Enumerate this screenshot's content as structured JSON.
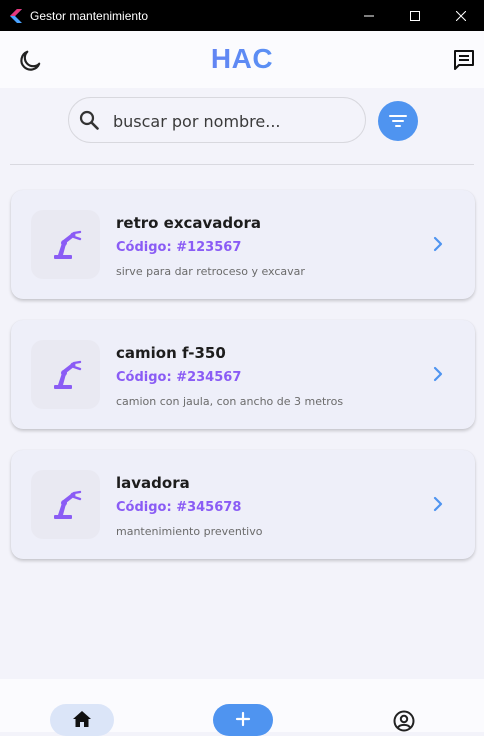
{
  "window": {
    "title": "Gestor mantenimiento",
    "controls": [
      "minimize-icon",
      "maximize-icon",
      "close-icon"
    ]
  },
  "appbar": {
    "logo": "HAC",
    "left_icon": "moon-icon",
    "right_icon": "chat-icon"
  },
  "search": {
    "placeholder": "buscar por nombre...",
    "value": "",
    "icon": "search-icon",
    "filter_icon": "filter-icon"
  },
  "items": [
    {
      "name": "retro excavadora",
      "code": "Código: #123567",
      "description": "sirve para dar retroceso y excavar",
      "icon": "robot-arm-icon"
    },
    {
      "name": "camion f-350",
      "code": "Código: #234567",
      "description": "camion con jaula, con ancho de 3 metros",
      "icon": "robot-arm-icon"
    },
    {
      "name": "lavadora",
      "code": "Código: #345678",
      "description": "mantenimiento preventivo",
      "icon": "robot-arm-icon"
    }
  ],
  "bottom_nav": {
    "items": [
      "home-icon",
      "add-icon",
      "profile-icon"
    ],
    "selected": "home-icon"
  },
  "colors": {
    "accent_blue": "#4f94f0",
    "accent_purple": "#8a5cf5",
    "card_bg": "#eeeff9",
    "page_bg": "#f3f3fa"
  }
}
